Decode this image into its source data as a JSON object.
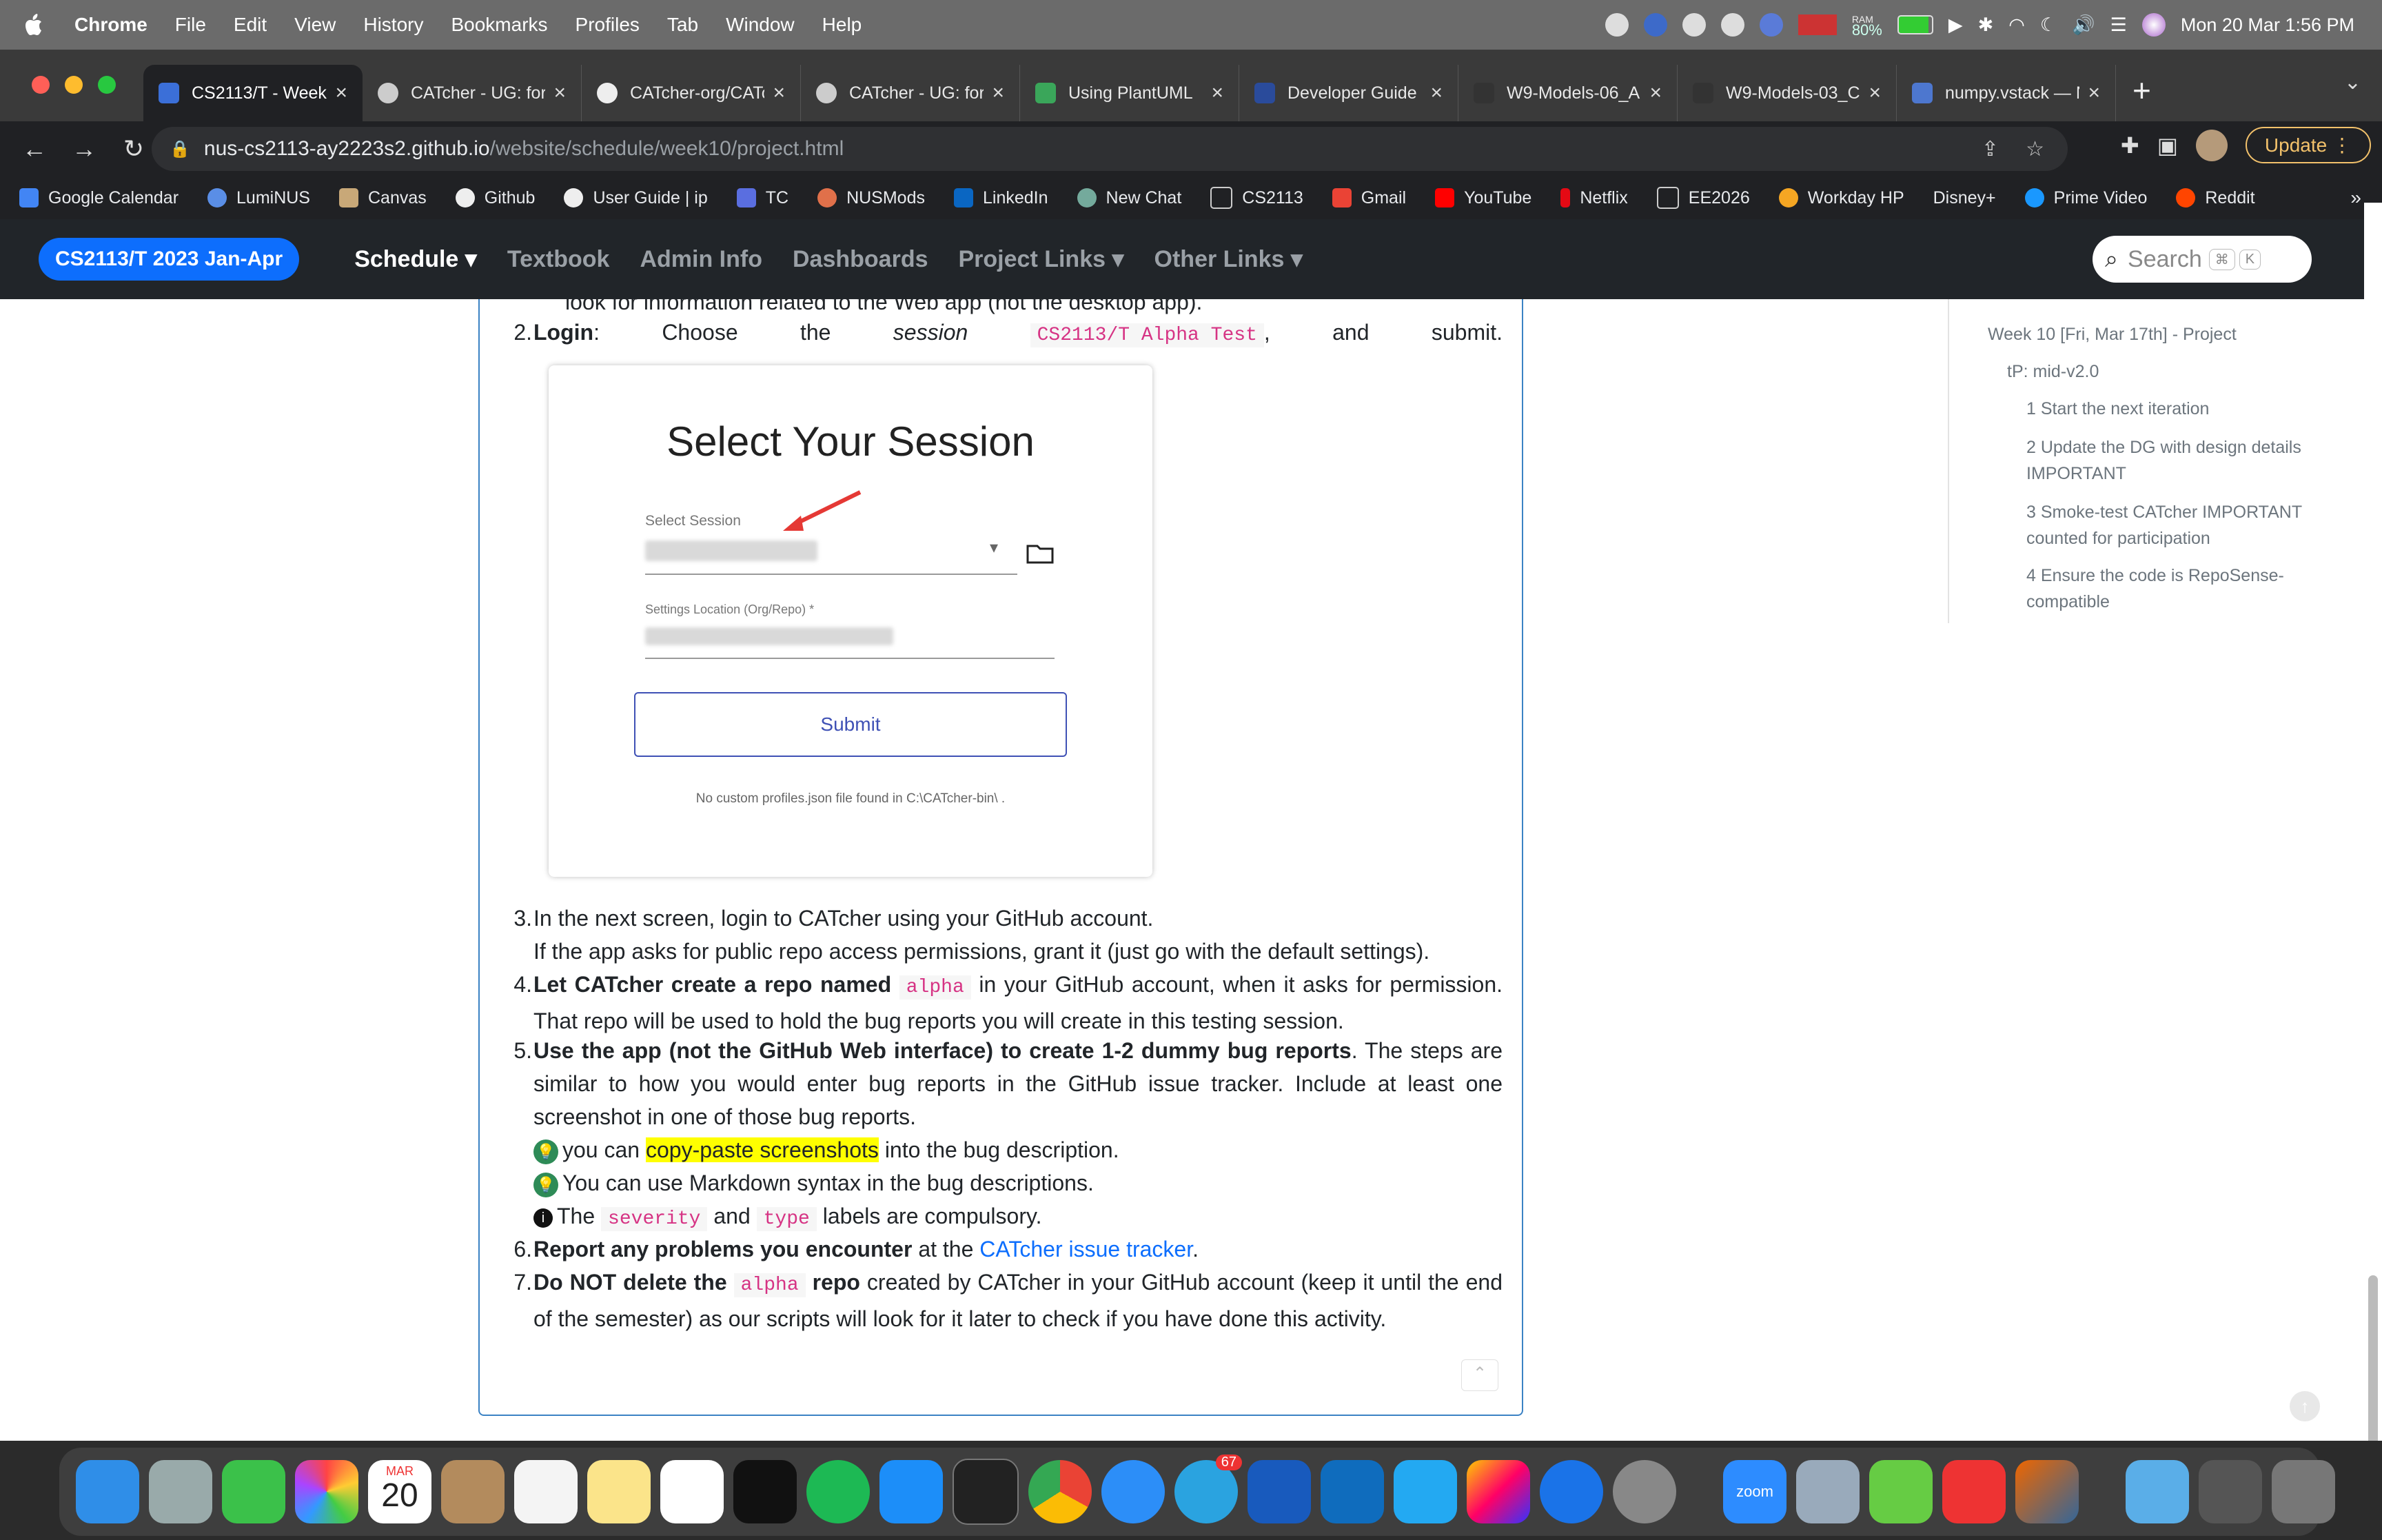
{
  "menubar": {
    "app": "Chrome",
    "items": [
      "File",
      "Edit",
      "View",
      "History",
      "Bookmarks",
      "Profiles",
      "Tab",
      "Window",
      "Help"
    ],
    "ram_label": "RAM",
    "ram_value": "80%",
    "clock": "Mon 20 Mar  1:56 PM"
  },
  "tabs": [
    {
      "title": "CS2113/T - Week",
      "active": true
    },
    {
      "title": "CATcher - UG: for"
    },
    {
      "title": "CATcher-org/CATc"
    },
    {
      "title": "CATcher - UG: for"
    },
    {
      "title": "Using PlantUML"
    },
    {
      "title": "Developer Guide"
    },
    {
      "title": "W9-Models-06_A"
    },
    {
      "title": "W9-Models-03_C"
    },
    {
      "title": "numpy.vstack — N"
    }
  ],
  "address": {
    "host": "nus-cs2113-ay2223s2.github.io",
    "path": "/website/schedule/week10/project.html",
    "update_label": "Update"
  },
  "bookmarks": [
    "Google Calendar",
    "LumiNUS",
    "Canvas",
    "Github",
    "User Guide | ip",
    "TC",
    "NUSMods",
    "LinkedIn",
    "New Chat",
    "CS2113",
    "Gmail",
    "YouTube",
    "Netflix",
    "EE2026",
    "Workday HP",
    "Disney+",
    "Prime Video",
    "Reddit"
  ],
  "site": {
    "brand": "CS2113/T 2023 Jan-Apr",
    "nav": [
      "Schedule ▾",
      "Textbook",
      "Admin Info",
      "Dashboards",
      "Project Links ▾",
      "Other Links ▾"
    ],
    "search_placeholder": "Search",
    "kbd1": "⌘",
    "kbd2": "K"
  },
  "content": {
    "topcut": "look for information related to the Web app (not the desktop app).",
    "step2_num": "2.",
    "step2_bold": "Login",
    "step2_text1": ": Choose the ",
    "step2_em": "session",
    "step2_code": "CS2113/T Alpha Test",
    "step2_text2": ", and submit.",
    "session_title": "Select Your Session",
    "session_label": "Select Session",
    "settings_label": "Settings Location (Org/Repo) *",
    "submit_label": "Submit",
    "session_note": "No custom profiles.json file found in C:\\CATcher-bin\\ .",
    "step3_num": "3.",
    "step3_l1": "In the next screen, login to CATcher using your GitHub account.",
    "step3_l2": "If the app asks for public repo access permissions, grant it (just go with the default settings).",
    "step4_num": "4.",
    "step4_bold": "Let CATcher create a repo named",
    "step4_code": "alpha",
    "step4_text": " in your GitHub account, when it asks for permission. That repo will be used to hold the bug reports you will create in this testing session.",
    "step5_num": "5.",
    "step5_bold": "Use the app (not the GitHub Web interface) to create 1-2 dummy bug reports",
    "step5_text": ". The steps are similar to how you would enter bug reports in the GitHub issue tracker. Include at least one screenshot in one of those bug reports.",
    "tip1_pre": "you can ",
    "tip1_hl": "copy-paste screenshots",
    "tip1_post": " into the bug description.",
    "tip2": "You can use Markdown syntax in the bug descriptions.",
    "info_pre": "The ",
    "info_code1": "severity",
    "info_mid": " and ",
    "info_code2": "type",
    "info_post": " labels are compulsory.",
    "step6_num": "6.",
    "step6_bold": "Report any problems you encounter",
    "step6_text": " at the ",
    "step6_link": "CATcher issue tracker",
    "step6_end": ".",
    "step7_num": "7.",
    "step7_bold1": "Do NOT delete the",
    "step7_code": "alpha",
    "step7_bold2": "repo",
    "step7_text": " created by CATcher in your GitHub account (keep it until the end of the semester) as our scripts will look for it later to check if you have done this activity."
  },
  "toc": [
    "Week 10 [Fri, Mar 17th] - Project",
    "tP: mid-v2.0",
    "1 Start the next iteration",
    "2 Update the DG with design details",
    "IMPORTANT",
    "3 Smoke-test CATcher IMPORTANT",
    "counted for participation",
    "4 Ensure the code is RepoSense-",
    "compatible"
  ],
  "dock": {
    "calendar_month": "MAR",
    "calendar_day": "20",
    "telegram_badge": "67",
    "zoom_label": "zoom"
  }
}
